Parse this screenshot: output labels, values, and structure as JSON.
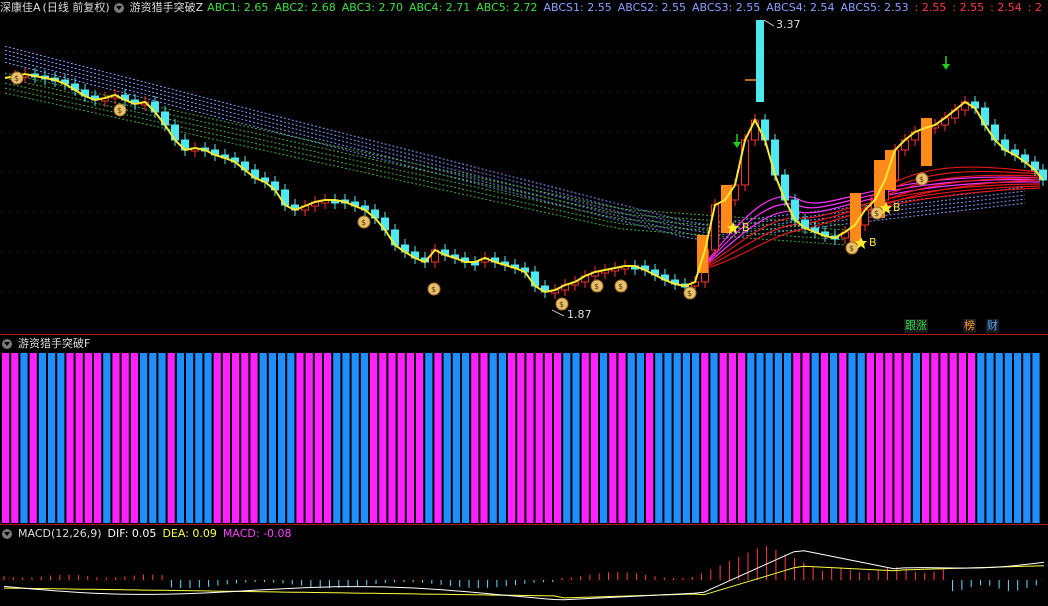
{
  "main": {
    "stock_label": "深康佳A",
    "period_label": "(日线 前复权)",
    "indicator_name": "游资猎手突破Z",
    "values": [
      {
        "name": "ABC1",
        "text": "ABC1: 2.65",
        "color": "#3fe03f"
      },
      {
        "name": "ABC2",
        "text": "ABC2: 2.68",
        "color": "#3fe03f"
      },
      {
        "name": "ABC3",
        "text": "ABC3: 2.70",
        "color": "#3fe03f"
      },
      {
        "name": "ABC4",
        "text": "ABC4: 2.71",
        "color": "#3fe03f"
      },
      {
        "name": "ABC5",
        "text": "ABC5: 2.72",
        "color": "#3fe03f"
      },
      {
        "name": "ABCS1",
        "text": "ABCS1: 2.55",
        "color": "#8aa0ff"
      },
      {
        "name": "ABCS2",
        "text": "ABCS2: 2.55",
        "color": "#8aa0ff"
      },
      {
        "name": "ABCS3",
        "text": "ABCS3: 2.55",
        "color": "#8aa0ff"
      },
      {
        "name": "ABCS4",
        "text": "ABCS4: 2.54",
        "color": "#8aa0ff"
      },
      {
        "name": "ABCS5",
        "text": "ABCS5: 2.53",
        "color": "#8aa0ff"
      },
      {
        "name": "R1",
        "text": ": 2.55",
        "color": "#ff3b3b"
      },
      {
        "name": "R2",
        "text": ": 2.55",
        "color": "#ff3b3b"
      },
      {
        "name": "R3",
        "text": ": 2.54",
        "color": "#ff3b3b"
      },
      {
        "name": "R4",
        "text": ": 2",
        "color": "#ff3b3b"
      }
    ],
    "high_label": "3.37",
    "low_label": "1.87",
    "b_marks": [
      "B",
      "B",
      "B"
    ],
    "tags": [
      {
        "text": "跟涨",
        "color": "#2fd84a"
      },
      {
        "text": "榜",
        "color": "#ff9a2a"
      },
      {
        "text": "财",
        "color": "#4aa8ff"
      }
    ]
  },
  "panel2": {
    "indicator_name": "游资猎手突破F",
    "bar_colors": [
      "#ff20ff",
      "#1f8fff"
    ],
    "bar_sequence": [
      1,
      1,
      0,
      1,
      0,
      0,
      0,
      1,
      1,
      1,
      1,
      0,
      1,
      1,
      1,
      0,
      0,
      0,
      1,
      0,
      0,
      0,
      0,
      1,
      1,
      1,
      1,
      1,
      0,
      0,
      0,
      0,
      1,
      1,
      1,
      1,
      0,
      0,
      0,
      0,
      1,
      1,
      1,
      1,
      1,
      1,
      0,
      1,
      0,
      0,
      0,
      1,
      1,
      0,
      0,
      1,
      1,
      1,
      1,
      1,
      1,
      0,
      0,
      1,
      1,
      0,
      1,
      1,
      0,
      0,
      1,
      0,
      0,
      0,
      0,
      0,
      1,
      0,
      1,
      1,
      1,
      0,
      0,
      0,
      0,
      0,
      1,
      1,
      0,
      1,
      0,
      1,
      0,
      0,
      1,
      1,
      1,
      1,
      1,
      0,
      1,
      1,
      1,
      1,
      1,
      1,
      0,
      0,
      0,
      0,
      0,
      0,
      0
    ]
  },
  "macd": {
    "title": "MACD(12,26,9)",
    "dif_text": "DIF: 0.05",
    "dea_text": "DEA: 0.09",
    "macd_text": "MACD: -0.08",
    "dif_color": "#ffffff",
    "dea_color": "#ffff40",
    "macd_color": "#ff40ff"
  }
}
